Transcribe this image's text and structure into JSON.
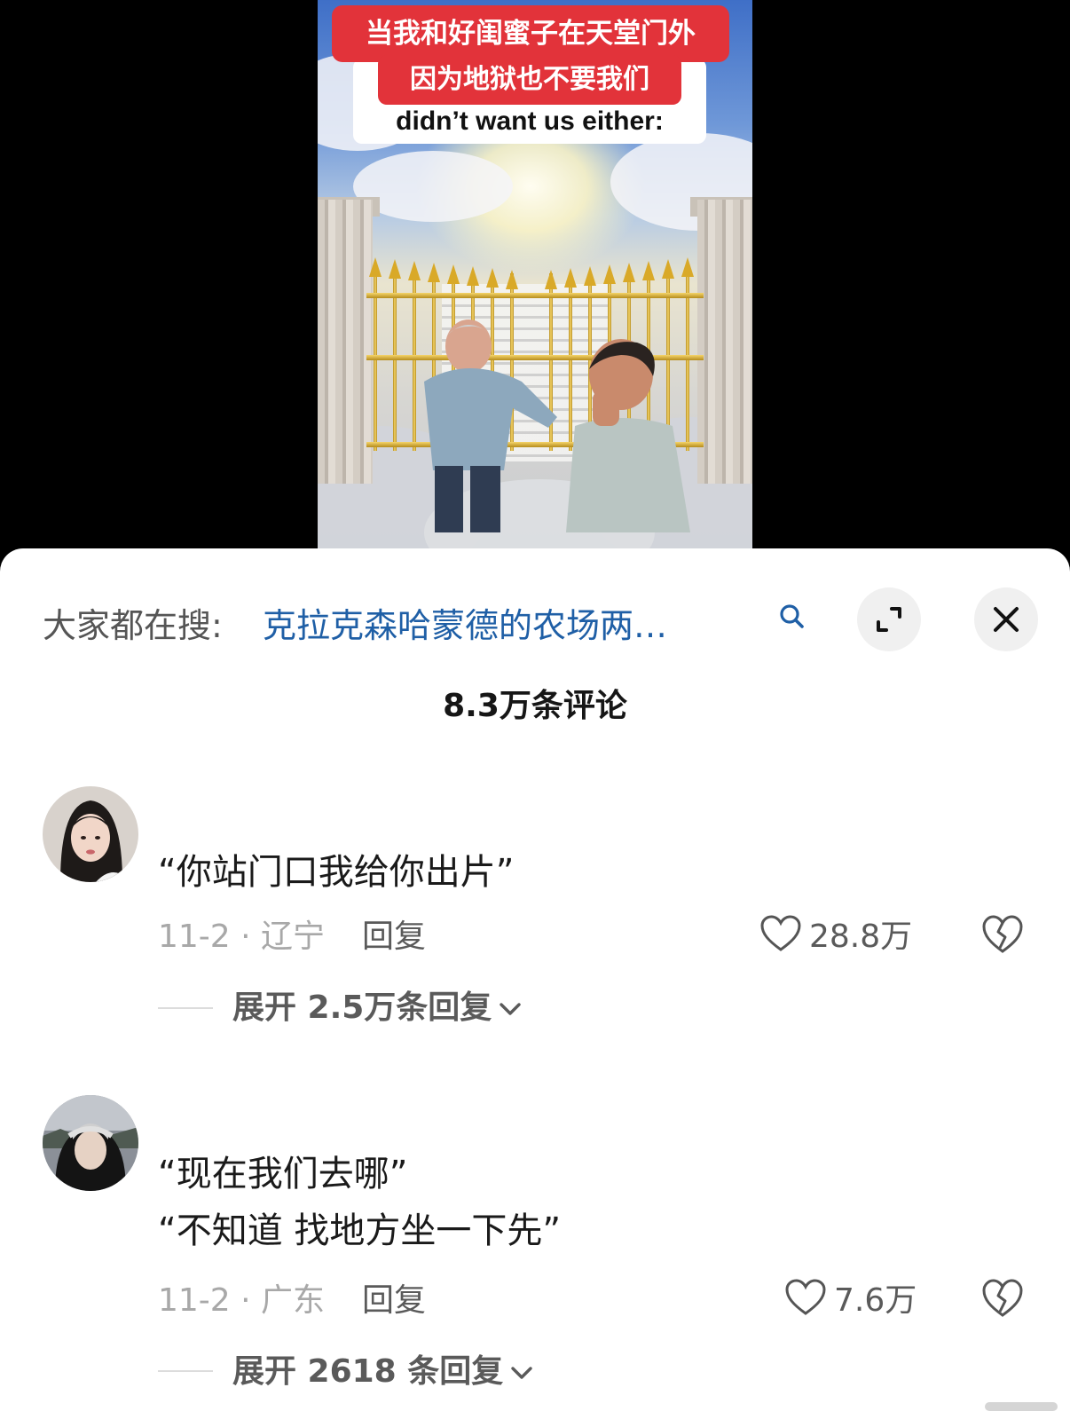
{
  "video": {
    "caption_cn_line1": "当我和好闺蜜子在天堂门外",
    "caption_cn_line2": "因为地狱也不要我们",
    "caption_en": "didn’t want us either:"
  },
  "search": {
    "prefix": "大家都在搜:",
    "query": "克拉克森哈蒙德的农场两…",
    "search_icon": "search-icon",
    "expand_icon": "expand-icon",
    "close_icon": "close-icon"
  },
  "comments_header": {
    "count_label": "8.3万条评论"
  },
  "comments": [
    {
      "text_lines": [
        "“你站门口我给你出片”"
      ],
      "date_location": "11-2 · 辽宁",
      "reply_label": "回复",
      "likes": "28.8万",
      "expand_label": "展开 2.5万条回复"
    },
    {
      "text_lines": [
        "“现在我们去哪”",
        "“不知道 找地方坐一下先”"
      ],
      "date_location": "11-2 · 广东",
      "reply_label": "回复",
      "likes": "7.6万",
      "expand_label": "展开 2618 条回复"
    }
  ],
  "colors": {
    "query_link": "#1f5fa6",
    "caption_red": "#e2333a"
  }
}
